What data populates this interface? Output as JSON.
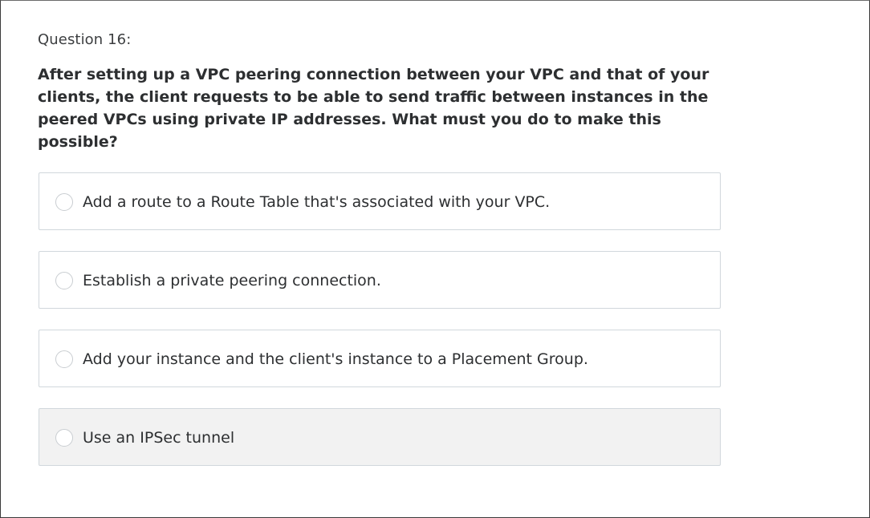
{
  "question": {
    "number_label": "Question 16:",
    "text": "After setting up a VPC peering connection between your VPC and that of your clients, the client requests to be able to send traffic between instances in the peered VPCs using private IP addresses. What must you do to make this possible?"
  },
  "options": [
    {
      "label": "Add a route to a Route Table that's associated with your VPC."
    },
    {
      "label": "Establish a private peering connection."
    },
    {
      "label": "Add your instance and the client's instance to a Placement Group."
    },
    {
      "label": "Use an IPSec tunnel"
    }
  ],
  "colors": {
    "border": "#d1d7dc",
    "hover_background": "#f2f2f2",
    "text": "#2d2f31"
  },
  "icons": {
    "option_radio": "radio-unchecked-icon"
  }
}
